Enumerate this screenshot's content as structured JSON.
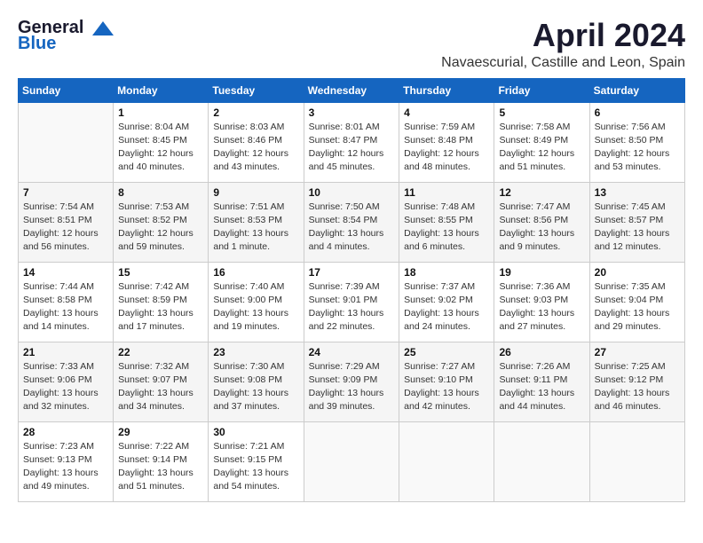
{
  "header": {
    "logo_line1": "General",
    "logo_line2": "Blue",
    "month_title": "April 2024",
    "subtitle": "Navaescurial, Castille and Leon, Spain"
  },
  "weekdays": [
    "Sunday",
    "Monday",
    "Tuesday",
    "Wednesday",
    "Thursday",
    "Friday",
    "Saturday"
  ],
  "weeks": [
    [
      {
        "day": "",
        "text": ""
      },
      {
        "day": "1",
        "text": "Sunrise: 8:04 AM\nSunset: 8:45 PM\nDaylight: 12 hours\nand 40 minutes."
      },
      {
        "day": "2",
        "text": "Sunrise: 8:03 AM\nSunset: 8:46 PM\nDaylight: 12 hours\nand 43 minutes."
      },
      {
        "day": "3",
        "text": "Sunrise: 8:01 AM\nSunset: 8:47 PM\nDaylight: 12 hours\nand 45 minutes."
      },
      {
        "day": "4",
        "text": "Sunrise: 7:59 AM\nSunset: 8:48 PM\nDaylight: 12 hours\nand 48 minutes."
      },
      {
        "day": "5",
        "text": "Sunrise: 7:58 AM\nSunset: 8:49 PM\nDaylight: 12 hours\nand 51 minutes."
      },
      {
        "day": "6",
        "text": "Sunrise: 7:56 AM\nSunset: 8:50 PM\nDaylight: 12 hours\nand 53 minutes."
      }
    ],
    [
      {
        "day": "7",
        "text": "Sunrise: 7:54 AM\nSunset: 8:51 PM\nDaylight: 12 hours\nand 56 minutes."
      },
      {
        "day": "8",
        "text": "Sunrise: 7:53 AM\nSunset: 8:52 PM\nDaylight: 12 hours\nand 59 minutes."
      },
      {
        "day": "9",
        "text": "Sunrise: 7:51 AM\nSunset: 8:53 PM\nDaylight: 13 hours\nand 1 minute."
      },
      {
        "day": "10",
        "text": "Sunrise: 7:50 AM\nSunset: 8:54 PM\nDaylight: 13 hours\nand 4 minutes."
      },
      {
        "day": "11",
        "text": "Sunrise: 7:48 AM\nSunset: 8:55 PM\nDaylight: 13 hours\nand 6 minutes."
      },
      {
        "day": "12",
        "text": "Sunrise: 7:47 AM\nSunset: 8:56 PM\nDaylight: 13 hours\nand 9 minutes."
      },
      {
        "day": "13",
        "text": "Sunrise: 7:45 AM\nSunset: 8:57 PM\nDaylight: 13 hours\nand 12 minutes."
      }
    ],
    [
      {
        "day": "14",
        "text": "Sunrise: 7:44 AM\nSunset: 8:58 PM\nDaylight: 13 hours\nand 14 minutes."
      },
      {
        "day": "15",
        "text": "Sunrise: 7:42 AM\nSunset: 8:59 PM\nDaylight: 13 hours\nand 17 minutes."
      },
      {
        "day": "16",
        "text": "Sunrise: 7:40 AM\nSunset: 9:00 PM\nDaylight: 13 hours\nand 19 minutes."
      },
      {
        "day": "17",
        "text": "Sunrise: 7:39 AM\nSunset: 9:01 PM\nDaylight: 13 hours\nand 22 minutes."
      },
      {
        "day": "18",
        "text": "Sunrise: 7:37 AM\nSunset: 9:02 PM\nDaylight: 13 hours\nand 24 minutes."
      },
      {
        "day": "19",
        "text": "Sunrise: 7:36 AM\nSunset: 9:03 PM\nDaylight: 13 hours\nand 27 minutes."
      },
      {
        "day": "20",
        "text": "Sunrise: 7:35 AM\nSunset: 9:04 PM\nDaylight: 13 hours\nand 29 minutes."
      }
    ],
    [
      {
        "day": "21",
        "text": "Sunrise: 7:33 AM\nSunset: 9:06 PM\nDaylight: 13 hours\nand 32 minutes."
      },
      {
        "day": "22",
        "text": "Sunrise: 7:32 AM\nSunset: 9:07 PM\nDaylight: 13 hours\nand 34 minutes."
      },
      {
        "day": "23",
        "text": "Sunrise: 7:30 AM\nSunset: 9:08 PM\nDaylight: 13 hours\nand 37 minutes."
      },
      {
        "day": "24",
        "text": "Sunrise: 7:29 AM\nSunset: 9:09 PM\nDaylight: 13 hours\nand 39 minutes."
      },
      {
        "day": "25",
        "text": "Sunrise: 7:27 AM\nSunset: 9:10 PM\nDaylight: 13 hours\nand 42 minutes."
      },
      {
        "day": "26",
        "text": "Sunrise: 7:26 AM\nSunset: 9:11 PM\nDaylight: 13 hours\nand 44 minutes."
      },
      {
        "day": "27",
        "text": "Sunrise: 7:25 AM\nSunset: 9:12 PM\nDaylight: 13 hours\nand 46 minutes."
      }
    ],
    [
      {
        "day": "28",
        "text": "Sunrise: 7:23 AM\nSunset: 9:13 PM\nDaylight: 13 hours\nand 49 minutes."
      },
      {
        "day": "29",
        "text": "Sunrise: 7:22 AM\nSunset: 9:14 PM\nDaylight: 13 hours\nand 51 minutes."
      },
      {
        "day": "30",
        "text": "Sunrise: 7:21 AM\nSunset: 9:15 PM\nDaylight: 13 hours\nand 54 minutes."
      },
      {
        "day": "",
        "text": ""
      },
      {
        "day": "",
        "text": ""
      },
      {
        "day": "",
        "text": ""
      },
      {
        "day": "",
        "text": ""
      }
    ]
  ]
}
